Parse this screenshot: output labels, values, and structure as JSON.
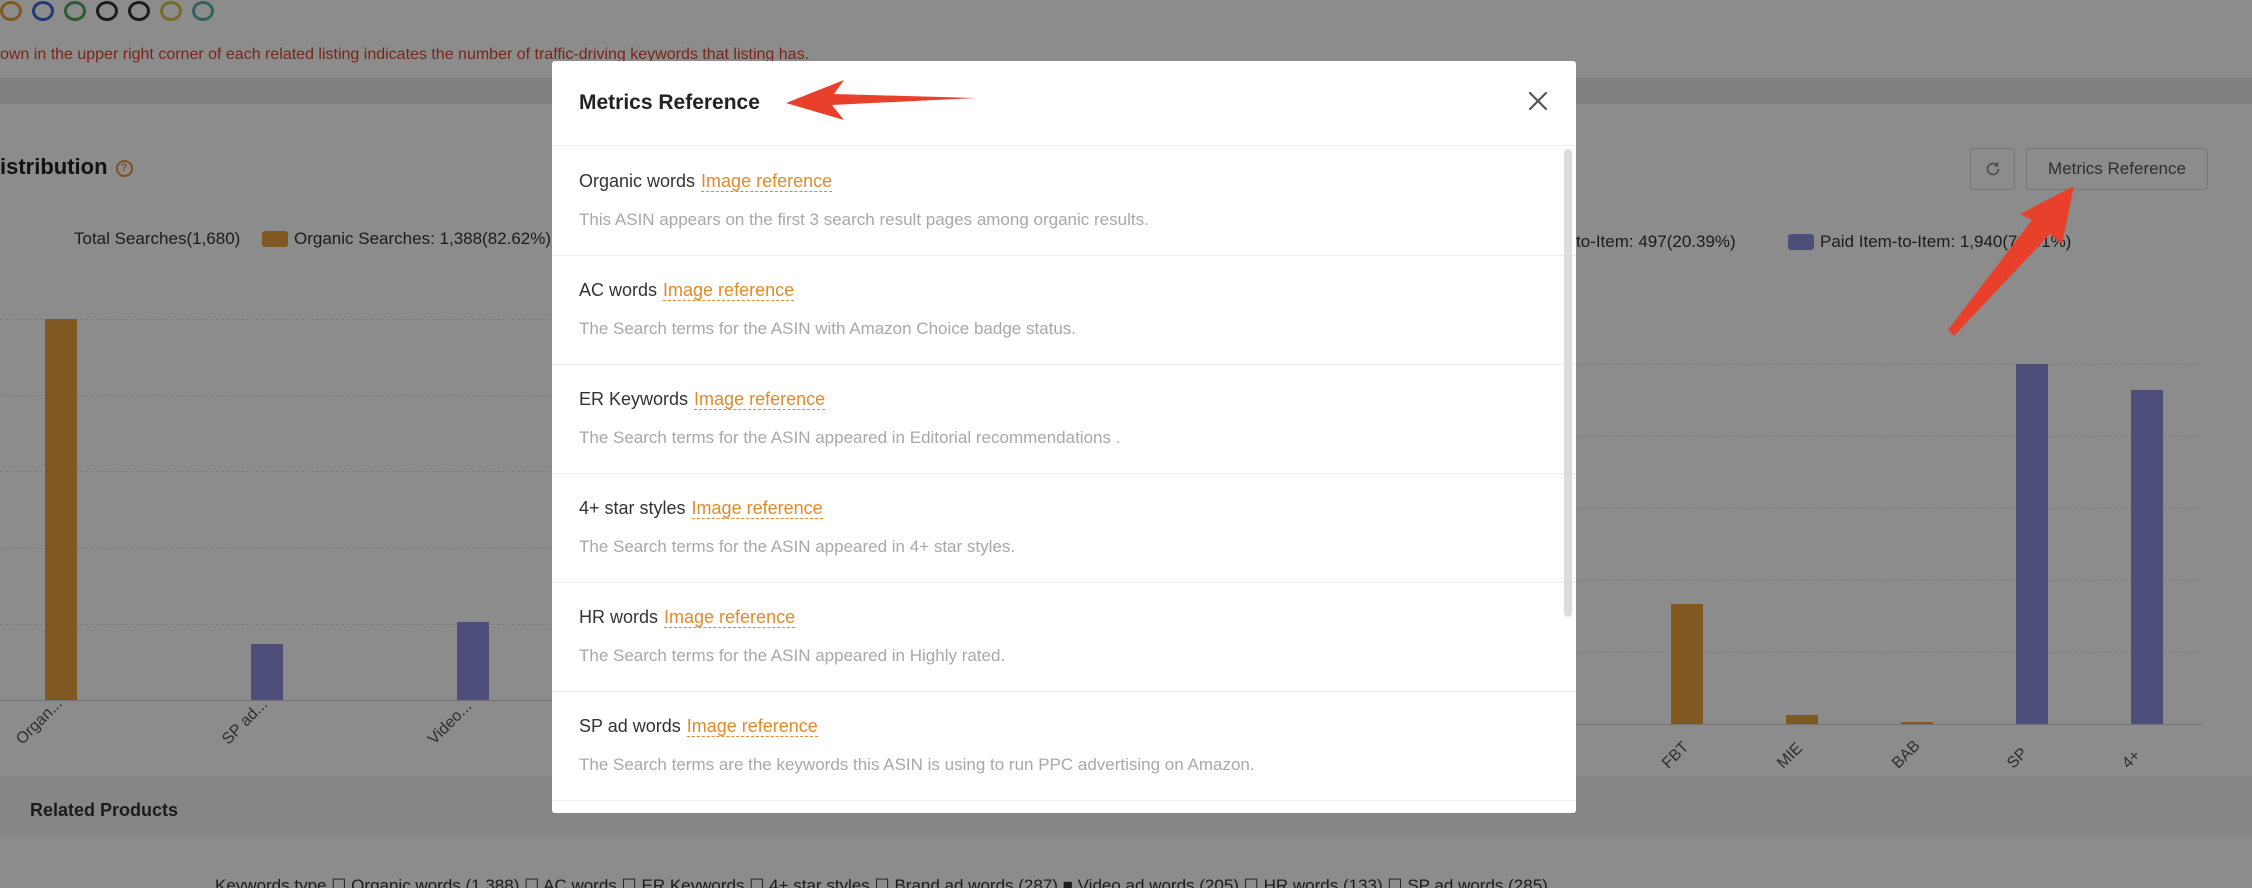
{
  "background": {
    "notice": "own in the upper right corner of each related listing indicates the number of traffic-driving keywords that listing has.",
    "section_title": "istribution",
    "metrics_button_label": "Metrics Reference",
    "legend": {
      "total": "Total Searches(1,680)",
      "organic": "Organic Searches: 1,388(82.62%)",
      "item_partial": "to-Item: 497(20.39%)",
      "paid_item": "Paid Item-to-Item: 1,940(79.61%)"
    },
    "left_ticks": [
      "Organ...",
      "SP ad...",
      "Video..."
    ],
    "right_ticks": [
      "FBT",
      "MIE",
      "BAB",
      "SP",
      "4+"
    ],
    "related_title": "Related Products",
    "keywords_row": "Keywords type  ☐ Organic words (1,388)   ☐ AC words   ☐ ER Keywords   ☐ 4+ star styles   ☐ Brand ad words (287)   ■ Video ad words (205)   ☐ HR words (133)   ☐ SP ad words (285)"
  },
  "chart_data": [
    {
      "type": "bar",
      "title": "",
      "categories": [
        "Organ...",
        "SP ad...",
        "Video..."
      ],
      "values": [
        1388,
        205,
        285
      ],
      "colors": [
        "#e8a33c",
        "#8c8fdc",
        "#8c8fdc"
      ]
    },
    {
      "type": "bar",
      "title": "",
      "categories": [
        "FBT",
        "MIE",
        "BAB",
        "SP",
        "4+"
      ],
      "values": [
        420,
        30,
        8,
        1260,
        1170
      ],
      "colors": [
        "#e8a33c",
        "#e8a33c",
        "#e8a33c",
        "#8c8fdc",
        "#8c8fdc"
      ]
    }
  ],
  "modal": {
    "title": "Metrics Reference",
    "link_label": "Image reference",
    "metrics": [
      {
        "name": "Organic words",
        "desc": "This ASIN appears on the first 3 search result pages among organic results."
      },
      {
        "name": "AC words",
        "desc": "The Search terms for the ASIN with Amazon Choice badge status."
      },
      {
        "name": "ER Keywords",
        "desc": "The Search terms for the ASIN appeared in Editorial recommendations ."
      },
      {
        "name": "4+ star styles",
        "desc": "The Search terms for the ASIN appeared in 4+ star styles."
      },
      {
        "name": "HR words",
        "desc": "The Search terms for the ASIN appeared in Highly rated."
      },
      {
        "name": "SP ad words",
        "desc": "The Search terms are the keywords this ASIN is using to run PPC advertising on Amazon."
      }
    ]
  },
  "colors": {
    "organic": "#e8a33c",
    "paid": "#8c8fdc",
    "link": "#e08a2c",
    "annotation_arrow": "#e8402a"
  }
}
